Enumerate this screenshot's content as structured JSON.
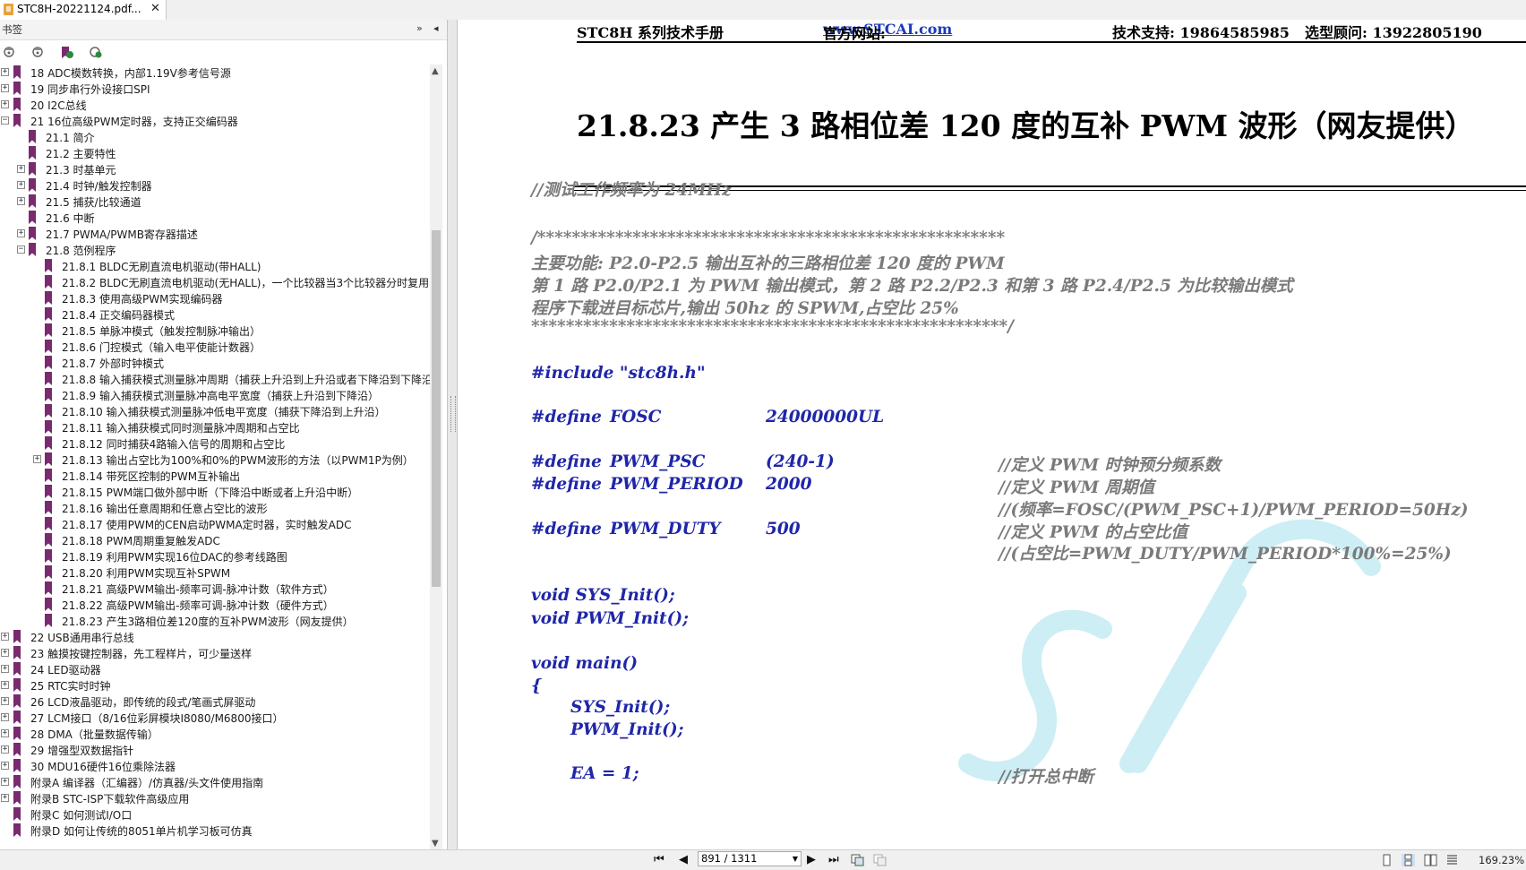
{
  "tab": {
    "title": "STC8H-20221124.pdf...",
    "close": "✕"
  },
  "panel": {
    "header": "书签",
    "collapse_btn": "»",
    "hide_btn": "◂",
    "toolbar_icons": [
      "bookmark-expand-icon",
      "bookmark-collapse-icon",
      "bookmark-add-icon",
      "bookmark-find-icon"
    ]
  },
  "bookmarks": [
    {
      "label": "18 ADC模数转换，内部1.19V参考信号源",
      "level": 0,
      "expander": "+"
    },
    {
      "label": "19 同步串行外设接口SPI",
      "level": 0,
      "expander": "+"
    },
    {
      "label": "20 I2C总线",
      "level": 0,
      "expander": "+"
    },
    {
      "label": "21 16位高级PWM定时器，支持正交编码器",
      "level": 0,
      "expander": "−"
    },
    {
      "label": "21.1 简介",
      "level": 1,
      "expander": ""
    },
    {
      "label": "21.2 主要特性",
      "level": 1,
      "expander": ""
    },
    {
      "label": "21.3 时基单元",
      "level": 1,
      "expander": "+"
    },
    {
      "label": "21.4 时钟/触发控制器",
      "level": 1,
      "expander": "+"
    },
    {
      "label": "21.5 捕获/比较通道",
      "level": 1,
      "expander": "+"
    },
    {
      "label": "21.6 中断",
      "level": 1,
      "expander": ""
    },
    {
      "label": "21.7 PWMA/PWMB寄存器描述",
      "level": 1,
      "expander": "+"
    },
    {
      "label": "21.8 范例程序",
      "level": 1,
      "expander": "−"
    },
    {
      "label": "21.8.1 BLDC无刷直流电机驱动(带HALL)",
      "level": 2,
      "expander": ""
    },
    {
      "label": "21.8.2 BLDC无刷直流电机驱动(无HALL)，一个比较器当3个比较器分时复用",
      "level": 2,
      "expander": ""
    },
    {
      "label": "21.8.3 使用高级PWM实现编码器",
      "level": 2,
      "expander": ""
    },
    {
      "label": "21.8.4 正交编码器模式",
      "level": 2,
      "expander": ""
    },
    {
      "label": "21.8.5 单脉冲模式（触发控制脉冲输出）",
      "level": 2,
      "expander": ""
    },
    {
      "label": "21.8.6 门控模式（输入电平使能计数器）",
      "level": 2,
      "expander": ""
    },
    {
      "label": "21.8.7 外部时钟模式",
      "level": 2,
      "expander": ""
    },
    {
      "label": "21.8.8 输入捕获模式测量脉冲周期（捕获上升沿到上升沿或者下降沿到下降沿",
      "level": 2,
      "expander": ""
    },
    {
      "label": "21.8.9 输入捕获模式测量脉冲高电平宽度（捕获上升沿到下降沿）",
      "level": 2,
      "expander": ""
    },
    {
      "label": "21.8.10 输入捕获模式测量脉冲低电平宽度（捕获下降沿到上升沿）",
      "level": 2,
      "expander": ""
    },
    {
      "label": "21.8.11 输入捕获模式同时测量脉冲周期和占空比",
      "level": 2,
      "expander": ""
    },
    {
      "label": "21.8.12 同时捕获4路输入信号的周期和占空比",
      "level": 2,
      "expander": ""
    },
    {
      "label": "21.8.13 输出占空比为100%和0%的PWM波形的方法（以PWM1P为例）",
      "level": 2,
      "expander": "+"
    },
    {
      "label": "21.8.14 带死区控制的PWM互补输出",
      "level": 2,
      "expander": ""
    },
    {
      "label": "21.8.15 PWM端口做外部中断（下降沿中断或者上升沿中断）",
      "level": 2,
      "expander": ""
    },
    {
      "label": "21.8.16 输出任意周期和任意占空比的波形",
      "level": 2,
      "expander": ""
    },
    {
      "label": "21.8.17 使用PWM的CEN启动PWMA定时器，实时触发ADC",
      "level": 2,
      "expander": ""
    },
    {
      "label": "21.8.18 PWM周期重复触发ADC",
      "level": 2,
      "expander": ""
    },
    {
      "label": "21.8.19 利用PWM实现16位DAC的参考线路图",
      "level": 2,
      "expander": ""
    },
    {
      "label": "21.8.20 利用PWM实现互补SPWM",
      "level": 2,
      "expander": ""
    },
    {
      "label": "21.8.21 高级PWM输出-频率可调-脉冲计数（软件方式）",
      "level": 2,
      "expander": ""
    },
    {
      "label": "21.8.22 高级PWM输出-频率可调-脉冲计数（硬件方式）",
      "level": 2,
      "expander": ""
    },
    {
      "label": "21.8.23 产生3路相位差120度的互补PWM波形（网友提供）",
      "level": 2,
      "expander": ""
    },
    {
      "label": "22 USB通用串行总线",
      "level": 0,
      "expander": "+"
    },
    {
      "label": "23 触摸按键控制器，先工程样片，可少量送样",
      "level": 0,
      "expander": "+"
    },
    {
      "label": "24 LED驱动器",
      "level": 0,
      "expander": "+"
    },
    {
      "label": "25 RTC实时时钟",
      "level": 0,
      "expander": "+"
    },
    {
      "label": "26 LCD液晶驱动，即传统的段式/笔画式屏驱动",
      "level": 0,
      "expander": "+"
    },
    {
      "label": "27 LCM接口（8/16位彩屏模块I8080/M6800接口）",
      "level": 0,
      "expander": "+"
    },
    {
      "label": "28 DMA（批量数据传输）",
      "level": 0,
      "expander": "+"
    },
    {
      "label": "29 增强型双数据指针",
      "level": 0,
      "expander": "+"
    },
    {
      "label": "30 MDU16硬件16位乘除法器",
      "level": 0,
      "expander": "+"
    },
    {
      "label": "附录A 编译器（汇编器）/仿真器/头文件使用指南",
      "level": 0,
      "expander": "+"
    },
    {
      "label": "附录B STC-ISP下载软件高级应用",
      "level": 0,
      "expander": "+"
    },
    {
      "label": "附录C 如何测试I/O口",
      "level": 0,
      "expander": ""
    },
    {
      "label": "附录D 如何让传统的8051单片机学习板可仿真",
      "level": 0,
      "expander": ""
    }
  ],
  "doc": {
    "running_head": {
      "manual": "STC8H 系列技术手册",
      "site_label": "官方网站:",
      "site_url": "www.STCAI.com",
      "support": "技术支持: 19864585985",
      "sales": "选型顾问: 13922805190"
    },
    "heading": "21.8.23  产生 3 路相位差 120 度的互补 PWM 波形（网友提供）",
    "code": {
      "test_freq": "//测试工作频率为 24MHz",
      "stars_open": "/******************************************************",
      "desc1": "主要功能: P2.0-P2.5 输出互补的三路相位差 120 度的 PWM",
      "desc2": "第 1 路 P2.0/P2.1 为 PWM 输出模式，第 2 路 P2.2/P2.3 和第 3 路 P2.4/P2.5 为比较输出模式",
      "desc3": "程序下载进目标芯片,输出 50hz 的 SPWM,占空比 25%",
      "stars_close": "*******************************************************/",
      "include": "#include \"stc8h.h\"",
      "def": "#define",
      "fosc_name": "FOSC",
      "fosc_val": "24000000UL",
      "psc_name": "PWM_PSC",
      "psc_val": "(240-1)",
      "psc_cmt": "//定义 PWM 时钟预分频系数",
      "period_name": "PWM_PERIOD",
      "period_val": "2000",
      "period_cmt": "//定义 PWM 周期值",
      "period_cmt2": "//(频率=FOSC/(PWM_PSC+1)/PWM_PERIOD=50Hz)",
      "duty_name": "PWM_DUTY",
      "duty_val": "500",
      "duty_cmt": "//定义 PWM 的占空比值",
      "duty_cmt2": "//(占空比=PWM_DUTY/PWM_PERIOD*100%=25%)",
      "proto1": "void SYS_Init();",
      "proto2": "void PWM_Init();",
      "main": "void main()",
      "brace": "{",
      "call1": "SYS_Init();",
      "call2": "PWM_Init();",
      "ea": "EA = 1;",
      "ea_cmt": "//打开总中断"
    }
  },
  "status": {
    "first": "⏮",
    "prev": "◀",
    "page": "891 / 1311",
    "next": "▶",
    "last": "⏭",
    "zoom": "169.23%"
  },
  "colors": {
    "code_blue": "#1f26a8",
    "comment_grey": "#7a7a7a",
    "bookmark": "#7a2a6e",
    "watermark": "#cdeef5"
  }
}
